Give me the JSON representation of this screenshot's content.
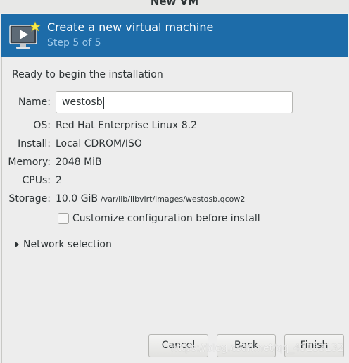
{
  "window": {
    "title": "New VM"
  },
  "header": {
    "icon": "monitor-play-icon",
    "title": "Create a new virtual machine",
    "step": "Step 5 of 5",
    "background_color": "#1d6ca9"
  },
  "main": {
    "ready_text": "Ready to begin the installation",
    "name": {
      "label": "Name:",
      "value": "westosb"
    },
    "os": {
      "label": "OS:",
      "value": "Red Hat Enterprise Linux 8.2"
    },
    "install": {
      "label": "Install:",
      "value": "Local CDROM/ISO"
    },
    "memory": {
      "label": "Memory:",
      "value": "2048 MiB"
    },
    "cpus": {
      "label": "CPUs:",
      "value": "2"
    },
    "storage": {
      "label": "Storage:",
      "value": "10.0 GiB",
      "path": "/var/lib/libvirt/images/westosb.qcow2"
    },
    "customize": {
      "label": "Customize configuration before install",
      "checked": false
    },
    "network_selection": {
      "label": "Network selection",
      "expanded": false
    }
  },
  "buttons": {
    "cancel": "Cancel",
    "back": "Back",
    "finish": "Finish"
  },
  "watermark": "https://blog.csdn.net/qq_43133132"
}
